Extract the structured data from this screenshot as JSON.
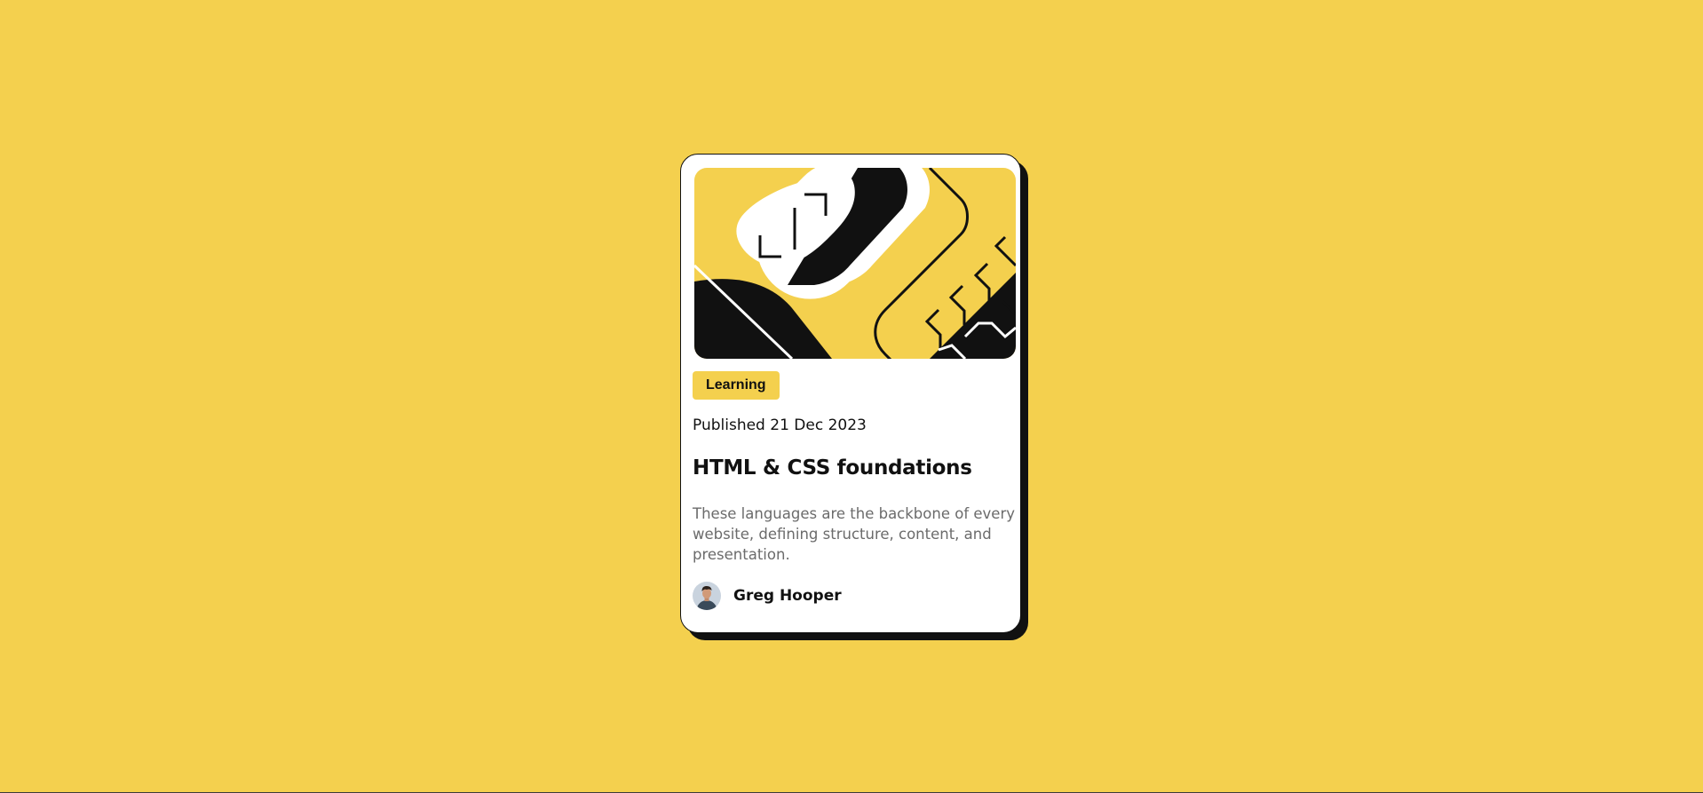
{
  "colors": {
    "background": "#f4d04e",
    "card": "#ffffff",
    "ink": "#111111",
    "muted_text": "#6b6b6b"
  },
  "card": {
    "category": "Learning",
    "published": "Published 21 Dec 2023",
    "title": "HTML & CSS foundations",
    "description": "These languages are the backbone of every website, defining structure, content, and presentation.",
    "author": {
      "name": "Greg Hooper",
      "avatar_icon": "avatar-photo"
    },
    "illustration_icon": "abstract-geometric-illustration"
  }
}
